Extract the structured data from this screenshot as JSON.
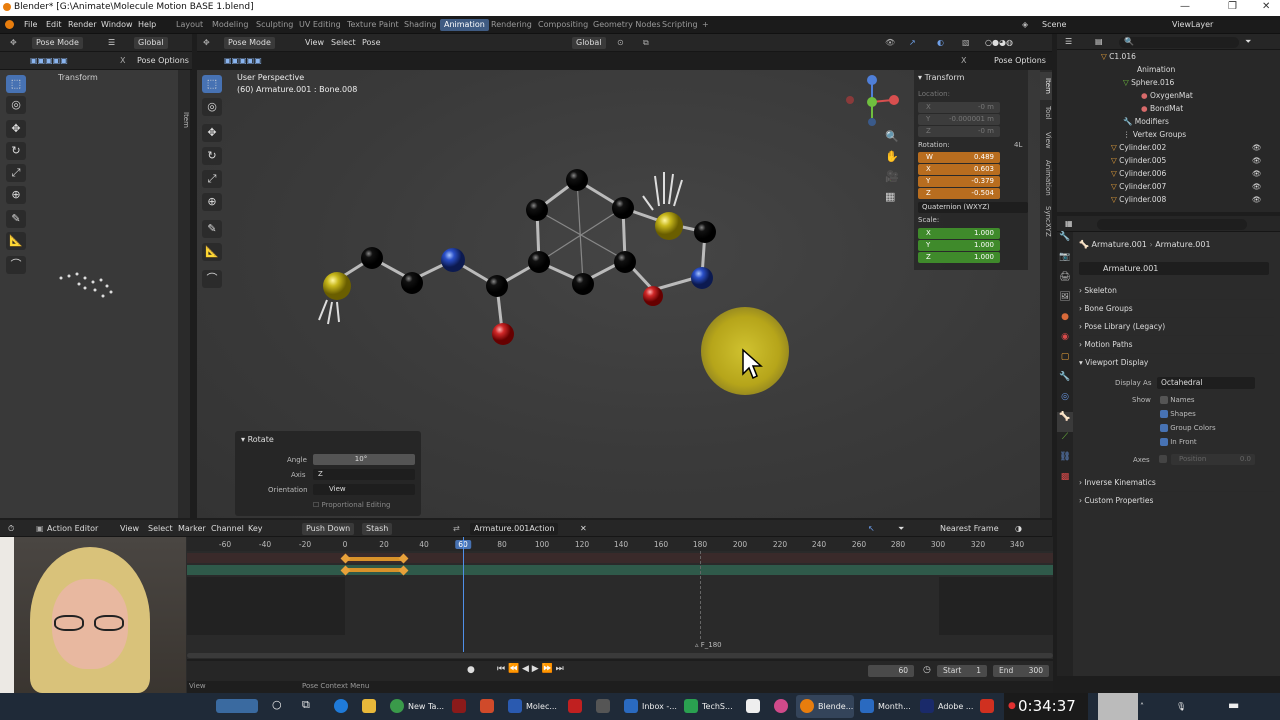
{
  "window": {
    "title": "Blender* [G:\\Animate\\Molecule Motion BASE 1.blend]"
  },
  "menu": {
    "items": [
      "File",
      "Edit",
      "Render",
      "Window",
      "Help"
    ]
  },
  "workspaces": [
    "Layout",
    "Modeling",
    "Sculpting",
    "UV Editing",
    "Texture Paint",
    "Shading",
    "Animation",
    "Rendering",
    "Compositing",
    "Geometry Nodes",
    "Scripting",
    "+"
  ],
  "active_workspace": "Animation",
  "scene": {
    "name": "Scene",
    "view_layer": "ViewLayer"
  },
  "left_editor": {
    "mode": "Pose Mode",
    "orientation": "Global",
    "options": "Pose Options",
    "panel": "Transform"
  },
  "viewport": {
    "mode": "Pose Mode",
    "menus": [
      "View",
      "Select",
      "Pose"
    ],
    "orientation": "Global",
    "options": "Pose Options",
    "info_line1": "User Perspective",
    "info_line2": "(60) Armature.001 : Bone.008",
    "side_tabs": [
      "Item",
      "Tool",
      "View",
      "Animation",
      "SyncXYZ"
    ],
    "transform_title": "Transform",
    "location_label": "Location:",
    "location": [
      "-0 m",
      "-0.000001 m",
      "-0 m"
    ],
    "rotation_label": "Rotation:",
    "rotation_mode_short": "4L",
    "rotation": [
      {
        "axis": "W",
        "value": "0.489"
      },
      {
        "axis": "X",
        "value": "0.603"
      },
      {
        "axis": "Y",
        "value": "-0.379"
      },
      {
        "axis": "Z",
        "value": "-0.504"
      }
    ],
    "rotation_mode": "Quaternion (WXYZ)",
    "scale_label": "Scale:",
    "scale": [
      {
        "axis": "X",
        "value": "1.000"
      },
      {
        "axis": "Y",
        "value": "1.000"
      },
      {
        "axis": "Z",
        "value": "1.000"
      }
    ],
    "loc_axes": [
      "X",
      "Y",
      "Z"
    ]
  },
  "operator_panel": {
    "title": "Rotate",
    "angle_label": "Angle",
    "angle_value": "10°",
    "axis_label": "Axis",
    "axis_value": "Z",
    "orientation_label": "Orientation",
    "orientation_value": "View",
    "proportional": "Proportional Editing"
  },
  "outliner": {
    "rows": [
      {
        "name": "C1.016",
        "indent": 1
      },
      {
        "name": "Animation",
        "indent": 2
      },
      {
        "name": "Sphere.016",
        "indent": 2
      },
      {
        "name": "OxygenMat",
        "indent": 3
      },
      {
        "name": "BondMat",
        "indent": 3
      },
      {
        "name": "Modifiers",
        "indent": 2
      },
      {
        "name": "Vertex Groups",
        "indent": 2
      },
      {
        "name": "Cylinder.002",
        "indent": 1
      },
      {
        "name": "Cylinder.005",
        "indent": 1
      },
      {
        "name": "Cylinder.006",
        "indent": 1
      },
      {
        "name": "Cylinder.007",
        "indent": 1
      },
      {
        "name": "Cylinder.008",
        "indent": 1
      }
    ]
  },
  "properties": {
    "breadcrumb_a": "Armature.001",
    "breadcrumb_b": "Armature.001",
    "data_name": "Armature.001",
    "sections": [
      "Skeleton",
      "Bone Groups",
      "Pose Library (Legacy)",
      "Motion Paths",
      "Viewport Display"
    ],
    "display_as_label": "Display As",
    "display_as_value": "Octahedral",
    "show_label": "Show",
    "checks": [
      {
        "label": "Names",
        "on": false
      },
      {
        "label": "Shapes",
        "on": true
      },
      {
        "label": "Group Colors",
        "on": true
      },
      {
        "label": "In Front",
        "on": true
      }
    ],
    "axes_label": "Axes",
    "axes_position": "Position",
    "axes_value": "0.0",
    "sections_after": [
      "Inverse Kinematics",
      "Custom Properties"
    ]
  },
  "action_editor": {
    "mode": "Action Editor",
    "menus": [
      "View",
      "Select",
      "Marker",
      "Channel",
      "Key"
    ],
    "push_down": "Push Down",
    "stash": "Stash",
    "action": "Armature.001Action",
    "snap": "Nearest Frame",
    "ruler": [
      "-60",
      "-40",
      "-20",
      "0",
      "20",
      "40",
      "60",
      "80",
      "100",
      "120",
      "140",
      "160",
      "180",
      "200",
      "220",
      "240",
      "260",
      "280",
      "300",
      "320",
      "340"
    ],
    "current_frame": "60",
    "marker": "F_180"
  },
  "playback": {
    "frame": "60",
    "start_label": "Start",
    "start": "1",
    "end_label": "End",
    "end": "300"
  },
  "status": {
    "left": "View",
    "mid": "Pose Context Menu"
  },
  "taskbar": {
    "items": [
      {
        "label": "New Ta..."
      },
      {
        "label": "Molec..."
      },
      {
        "label": "Inbox -..."
      },
      {
        "label": "TechS..."
      },
      {
        "label": "Blende..."
      },
      {
        "label": "Month..."
      },
      {
        "label": "Adobe ..."
      }
    ],
    "recording_time": "0:34:37"
  }
}
